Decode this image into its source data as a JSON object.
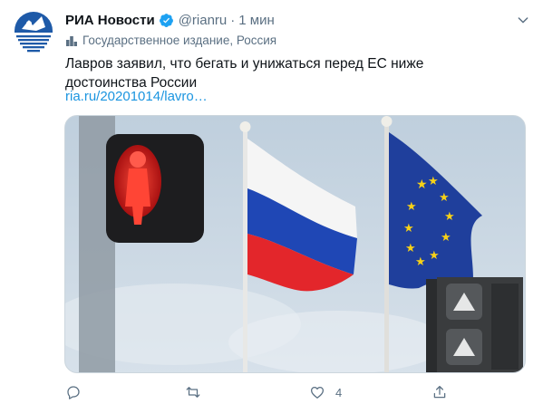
{
  "tweet": {
    "author_name": "РИА Новости",
    "handle": "@rianru",
    "separator": "·",
    "time": "1 мин",
    "account_label": "Государственное издание, Россия",
    "text": "Лавров заявил, что бегать и унижаться перед ЕС ниже достоинства России",
    "link": "ria.ru/20201014/lavro…"
  },
  "actions": {
    "reply_count": "",
    "retweet_count": "",
    "like_count": "4",
    "share_count": ""
  },
  "icons": {
    "verified": "verified-badge-icon",
    "label": "podium-icon",
    "caret": "chevron-down-icon",
    "reply": "reply-icon",
    "retweet": "retweet-icon",
    "like": "heart-icon",
    "share": "share-icon"
  },
  "colors": {
    "accent": "#1da1f2",
    "link": "#1b95e0",
    "secondary_text": "#5b7083",
    "brand_blue": "#1e5aa8"
  }
}
